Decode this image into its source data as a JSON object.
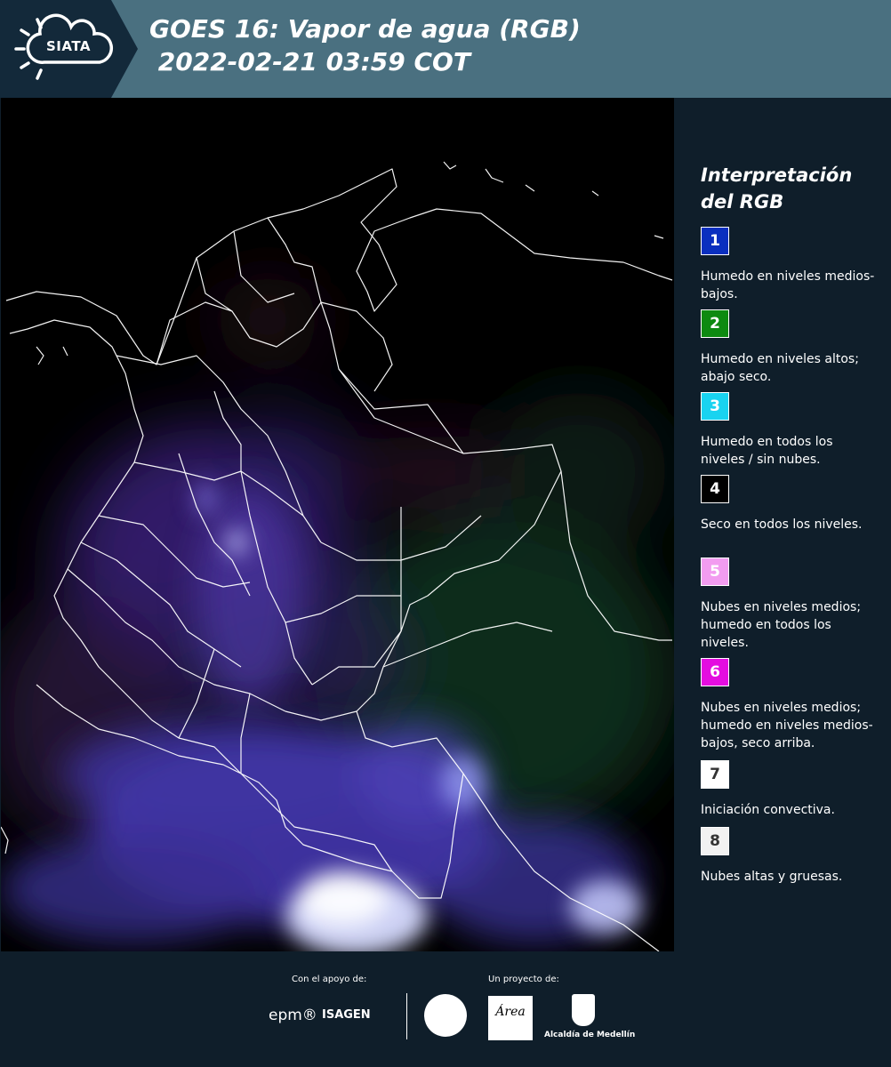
{
  "header": {
    "logo": "SIATA",
    "title": "GOES 16: Vapor de agua (RGB)\n 2022-02-21 03:59 COT",
    "background_color": "#4a7080",
    "logo_background_color": "#13293a"
  },
  "map": {
    "region": "Colombia"
  },
  "legend": {
    "title": "Interpretación del RGB",
    "items": [
      {
        "number": "1",
        "color": "#0a2fbf",
        "text_color": "#ffffff",
        "description": "Humedo en niveles medios-bajos."
      },
      {
        "number": "2",
        "color": "#0d8a10",
        "text_color": "#ffffff",
        "description": "Humedo en niveles altos; abajo seco."
      },
      {
        "number": "3",
        "color": "#19d3f0",
        "text_color": "#ffffff",
        "description": "Humedo en todos los niveles / sin nubes."
      },
      {
        "number": "4",
        "color": "#000000",
        "text_color": "#ffffff",
        "description": "Seco en todos los niveles."
      },
      {
        "number": "5",
        "color": "#f29cf0",
        "text_color": "#ffffff",
        "description": "Nubes en niveles medios; humedo en todos los niveles."
      },
      {
        "number": "6",
        "color": "#e40de0",
        "text_color": "#ffffff",
        "description": "Nubes en niveles medios; humedo en niveles medios-bajos, seco arriba."
      },
      {
        "number": "7",
        "color": "#ffffff",
        "text_color": "#333333",
        "description": "Iniciación convectiva."
      },
      {
        "number": "8",
        "color": "#f2f2f2",
        "text_color": "#333333",
        "description": "Nubes altas y gruesas."
      }
    ]
  },
  "footer": {
    "support_label": "Con el apoyo de:",
    "project_label": "Un proyecto de:",
    "sponsors": [
      "epm®",
      "ISAGEN"
    ],
    "amva_logo": "Área",
    "alcaldia": "Alcaldía de Medellín"
  }
}
